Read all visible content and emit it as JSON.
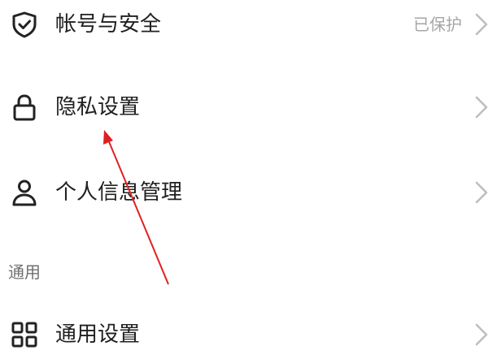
{
  "settings": {
    "items": [
      {
        "label": "帐号与安全",
        "status": "已保护",
        "icon": "shield-check-icon"
      },
      {
        "label": "隐私设置",
        "icon": "lock-icon"
      },
      {
        "label": "个人信息管理",
        "icon": "user-icon"
      }
    ],
    "section": {
      "header": "通用",
      "items": [
        {
          "label": "通用设置",
          "icon": "grid-icon"
        }
      ]
    }
  },
  "colors": {
    "annotation_arrow": "#e02020",
    "status_text": "#a6a6a6",
    "chevron": "#bdbdbd",
    "icon": "#222222"
  }
}
